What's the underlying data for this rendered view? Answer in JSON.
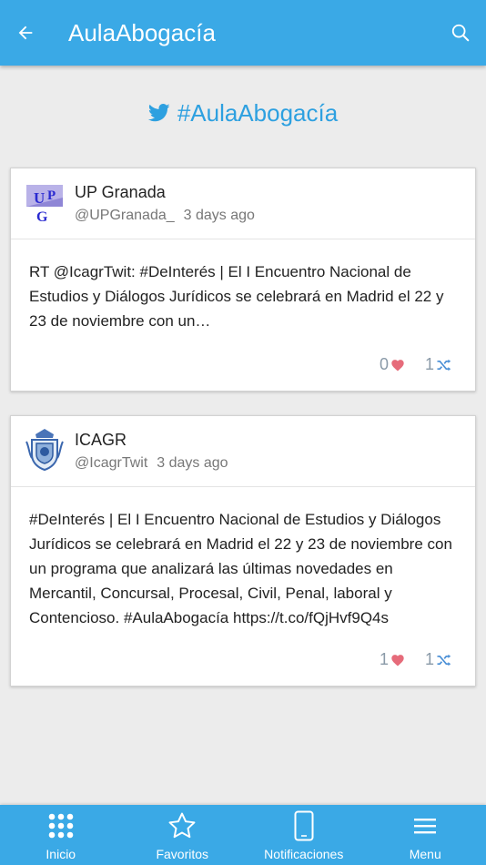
{
  "header": {
    "title": "AulaAbogacía",
    "back_icon": "arrow-left-icon",
    "search_icon": "search-icon"
  },
  "feed": {
    "hashtag": "#AulaAbogacía",
    "icon": "twitter-icon"
  },
  "tweets": [
    {
      "name": "UP Granada",
      "handle": "@UPGranada_",
      "time": "3 days ago",
      "avatar": "upg-logo",
      "text": "RT @IcagrTwit: #DeInterés | El I Encuentro Nacional de Estudios y Diálogos Jurídicos se celebrará en Madrid el 22 y 23 de noviembre con un…",
      "likes": "0",
      "retweets": "1"
    },
    {
      "name": "ICAGR",
      "handle": "@IcagrTwit",
      "time": "3 days ago",
      "avatar": "icagr-crest",
      "text": "#DeInterés | El I Encuentro Nacional de Estudios y Diálogos Jurídicos se celebrará en Madrid el 22 y 23 de noviembre con un programa que analizará las últimas novedades en Mercantil, Concursal, Procesal, Civil, Penal, laboral y Contencioso. #AulaAbogacía https://t.co/fQjHvf9Q4s",
      "likes": "1",
      "retweets": "1"
    }
  ],
  "nav": {
    "items": [
      {
        "label": "Inicio",
        "icon": "grid-icon"
      },
      {
        "label": "Favoritos",
        "icon": "star-icon"
      },
      {
        "label": "Notificaciones",
        "icon": "phone-icon"
      },
      {
        "label": "Menu",
        "icon": "menu-icon"
      }
    ]
  },
  "colors": {
    "primary": "#3aa9e6",
    "hashtag": "#2da0e0",
    "heart": "#e66b7a",
    "retweet": "#4a8fd6"
  }
}
